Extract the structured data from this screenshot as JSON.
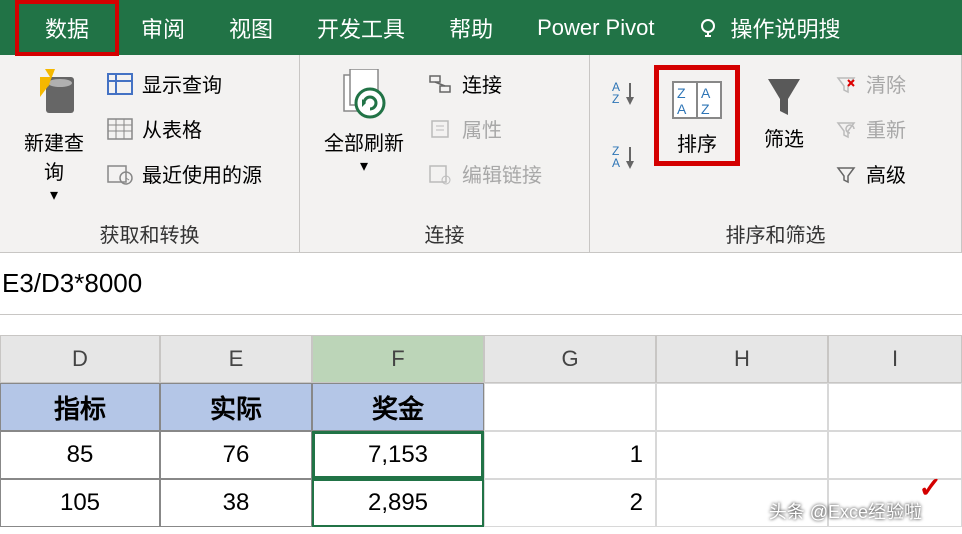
{
  "tabs": {
    "data": "数据",
    "review": "审阅",
    "view": "视图",
    "developer": "开发工具",
    "help": "帮助",
    "powerpivot": "Power Pivot",
    "tellme": "操作说明搜"
  },
  "ribbon": {
    "get_transform": {
      "new_query": "新建查\n询",
      "show_queries": "显示查询",
      "from_table": "从表格",
      "recent_sources": "最近使用的源",
      "label": "获取和转换"
    },
    "connections": {
      "refresh_all": "全部刷新",
      "connections": "连接",
      "properties": "属性",
      "edit_links": "编辑链接",
      "label": "连接"
    },
    "sort_filter": {
      "sort": "排序",
      "filter": "筛选",
      "clear": "清除",
      "reapply": "重新",
      "advanced": "高级",
      "label": "排序和筛选"
    }
  },
  "formula": "E3/D3*8000",
  "columns": {
    "D": "D",
    "E": "E",
    "F": "F",
    "G": "G",
    "H": "H",
    "I": "I"
  },
  "headers": {
    "D": "指标",
    "E": "实际",
    "F": "奖金"
  },
  "rows": [
    {
      "D": "85",
      "E": "76",
      "F": "7,153",
      "G": "1"
    },
    {
      "D": "105",
      "E": "38",
      "F": "2,895",
      "G": "2"
    }
  ],
  "watermark": "头条 @Exce经验啦",
  "watermark_url": "jingyanla.com",
  "chart_data": {
    "type": "table",
    "title": "",
    "columns": [
      "指标",
      "实际",
      "奖金"
    ],
    "rows": [
      [
        85,
        76,
        7153
      ],
      [
        105,
        38,
        2895
      ]
    ],
    "formula": "E3/D3*8000"
  }
}
